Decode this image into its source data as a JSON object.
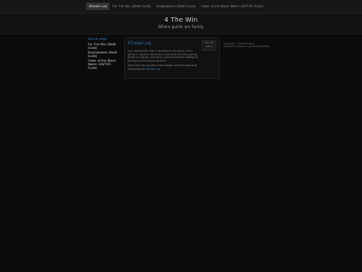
{
  "topnav": {
    "items": [
      {
        "label": "4thewin.org",
        "active": true
      },
      {
        "label": "For The Win (WoW Guild)",
        "active": false
      },
      {
        "label": "Knightwhere (WoW Guild)",
        "active": false
      },
      {
        "label": "Order of the Black Watch (SWTOR Guild)",
        "active": false
      }
    ]
  },
  "header": {
    "title": "4 The Win",
    "tagline": "Where guilds are Family"
  },
  "sidebar": {
    "heading": "Active page",
    "links": [
      "For The Win (WoW Guild)",
      "Knightwhere (WoW Guild)",
      "Order of the Black Watch (SWTOR Guild)"
    ]
  },
  "main": {
    "title": "4Thewin.org",
    "date_month": "Feb 18",
    "date_year": "2013",
    "paragraph1": "is an organization that is dedicated to the game and to gamers in general. We build a community of online gaming guilds and players, providing a place to share knowledge of gaming and the people behind it.",
    "paragraph2_prefix": "Setup free info provided in the header and home elements, represented by ",
    "paragraph2_link": "4thewin.org"
  },
  "right": {
    "line1": "Copyright © 2013 Pangaea",
    "line2": "Powered by 4thewin.org Website Builder"
  },
  "colors": {
    "accent": "#3d7ab8",
    "background": "#0b0b0b"
  }
}
